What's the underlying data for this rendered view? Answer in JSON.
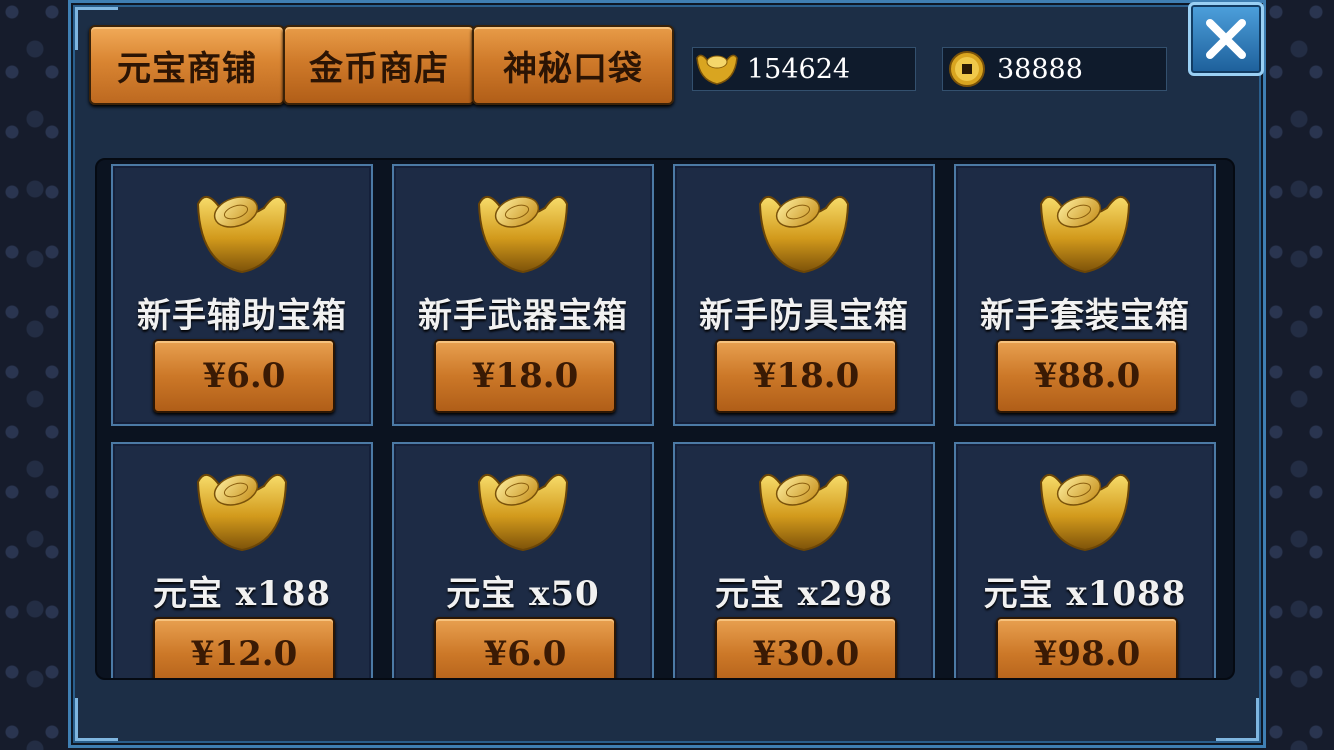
{
  "tabs": [
    {
      "label": "元宝商铺",
      "active": true
    },
    {
      "label": "金币商店",
      "active": false
    },
    {
      "label": "神秘口袋",
      "active": false
    }
  ],
  "currency": {
    "ingot": {
      "icon": "gold-ingot-icon",
      "value": "154624"
    },
    "coin": {
      "icon": "gold-coin-icon",
      "value": "38888"
    }
  },
  "close_icon": "close-icon",
  "items": [
    {
      "name": "新手辅助宝箱",
      "price": "¥6.0",
      "icon": "gold-ingot-icon"
    },
    {
      "name": "新手武器宝箱",
      "price": "¥18.0",
      "icon": "gold-ingot-icon"
    },
    {
      "name": "新手防具宝箱",
      "price": "¥18.0",
      "icon": "gold-ingot-icon"
    },
    {
      "name": "新手套装宝箱",
      "price": "¥88.0",
      "icon": "gold-ingot-icon"
    },
    {
      "name": "元宝 x188",
      "price": "¥12.0",
      "icon": "gold-ingot-icon"
    },
    {
      "name": "元宝 x50",
      "price": "¥6.0",
      "icon": "gold-ingot-icon"
    },
    {
      "name": "元宝 x298",
      "price": "¥30.0",
      "icon": "gold-ingot-icon"
    },
    {
      "name": "元宝 x1088",
      "price": "¥98.0",
      "icon": "gold-ingot-icon"
    }
  ],
  "colors": {
    "accent_orange": "#cf7a2a",
    "frame_blue": "#3f7fb3",
    "panel_bg": "#1d2b45"
  }
}
